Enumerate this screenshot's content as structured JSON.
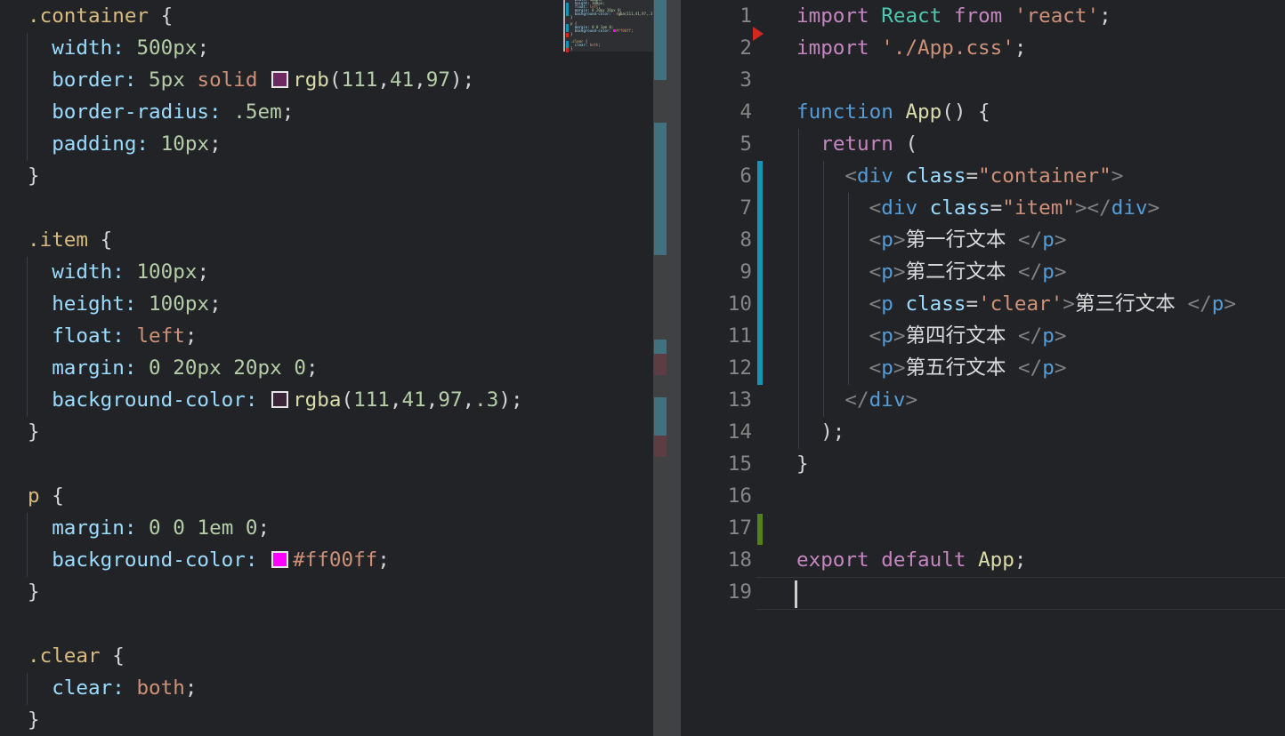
{
  "app": {
    "type": "code-editor-split-view"
  },
  "palette": {
    "k": "#C586C0",
    "s": "#569CD6",
    "c": "#4EC9B0",
    "f": "#DCDCAA",
    "str": "#CE9178",
    "a": "#9CDCFE",
    "n": "#B5CEA8",
    "p": "#D4D4D4",
    "g": "#808080",
    "t": "#569CD6",
    "sel": "#D7BA7D",
    "v": "#CE9178",
    "fn": "#DCDCAA",
    "txt": "#DCDCDC"
  },
  "ui_colors": {
    "bg": "#212327",
    "rulerBase": "#404143",
    "rulerModified": "#41707f",
    "rulerDeleted": "#5e3c43",
    "gutterModified": "#1792b6",
    "gutterAdded": "#54801a",
    "deletedMark": "#d2281e",
    "cursor": "#cfcfcf",
    "lineNumber": "#858585",
    "indentGuide": "#3b3f45",
    "currentLineBorder": "#32353a",
    "minimapSliderEdge": "#b5b5b5",
    "swatchBorder": "#e6e6e6"
  },
  "left_editor": {
    "language": "css",
    "lines": [
      [
        {
          "t": ".container",
          "c": "sel"
        },
        {
          "t": " {",
          "c": "p"
        }
      ],
      [
        {
          "t": "  width:",
          "c": "a"
        },
        {
          "t": " ",
          "c": "p"
        },
        {
          "t": "500px",
          "c": "n"
        },
        {
          "t": ";",
          "c": "p"
        }
      ],
      [
        {
          "t": "  border:",
          "c": "a"
        },
        {
          "t": " ",
          "c": "p"
        },
        {
          "t": "5px",
          "c": "n"
        },
        {
          "t": " ",
          "c": "p"
        },
        {
          "t": "solid",
          "c": "v"
        },
        {
          "t": " ",
          "c": "p"
        },
        {
          "swatch": "#6f2961"
        },
        {
          "t": "rgb",
          "c": "fn"
        },
        {
          "t": "(",
          "c": "p"
        },
        {
          "t": "111",
          "c": "n"
        },
        {
          "t": ",",
          "c": "p"
        },
        {
          "t": "41",
          "c": "n"
        },
        {
          "t": ",",
          "c": "p"
        },
        {
          "t": "97",
          "c": "n"
        },
        {
          "t": ");",
          "c": "p"
        }
      ],
      [
        {
          "t": "  border-radius:",
          "c": "a"
        },
        {
          "t": " ",
          "c": "p"
        },
        {
          "t": ".5em",
          "c": "n"
        },
        {
          "t": ";",
          "c": "p"
        }
      ],
      [
        {
          "t": "  padding:",
          "c": "a"
        },
        {
          "t": " ",
          "c": "p"
        },
        {
          "t": "10px",
          "c": "n"
        },
        {
          "t": ";",
          "c": "p"
        }
      ],
      [
        {
          "t": "}",
          "c": "p"
        }
      ],
      [],
      [
        {
          "t": ".item",
          "c": "sel"
        },
        {
          "t": " {",
          "c": "p"
        }
      ],
      [
        {
          "t": "  width:",
          "c": "a"
        },
        {
          "t": " ",
          "c": "p"
        },
        {
          "t": "100px",
          "c": "n"
        },
        {
          "t": ";",
          "c": "p"
        }
      ],
      [
        {
          "t": "  height:",
          "c": "a"
        },
        {
          "t": " ",
          "c": "p"
        },
        {
          "t": "100px",
          "c": "n"
        },
        {
          "t": ";",
          "c": "p"
        }
      ],
      [
        {
          "t": "  float:",
          "c": "a"
        },
        {
          "t": " ",
          "c": "p"
        },
        {
          "t": "left",
          "c": "v"
        },
        {
          "t": ";",
          "c": "p"
        }
      ],
      [
        {
          "t": "  margin:",
          "c": "a"
        },
        {
          "t": " ",
          "c": "p"
        },
        {
          "t": "0",
          "c": "n"
        },
        {
          "t": " ",
          "c": "p"
        },
        {
          "t": "20px",
          "c": "n"
        },
        {
          "t": " ",
          "c": "p"
        },
        {
          "t": "20px",
          "c": "n"
        },
        {
          "t": " ",
          "c": "p"
        },
        {
          "t": "0",
          "c": "n"
        },
        {
          "t": ";",
          "c": "p"
        }
      ],
      [
        {
          "t": "  background-color:",
          "c": "a"
        },
        {
          "t": " ",
          "c": "p"
        },
        {
          "swatch": "rgba(111,41,97,0.3)"
        },
        {
          "t": "rgba",
          "c": "fn"
        },
        {
          "t": "(",
          "c": "p"
        },
        {
          "t": "111",
          "c": "n"
        },
        {
          "t": ",",
          "c": "p"
        },
        {
          "t": "41",
          "c": "n"
        },
        {
          "t": ",",
          "c": "p"
        },
        {
          "t": "97",
          "c": "n"
        },
        {
          "t": ",",
          "c": "p"
        },
        {
          "t": ".3",
          "c": "n"
        },
        {
          "t": ");",
          "c": "p"
        }
      ],
      [
        {
          "t": "}",
          "c": "p"
        }
      ],
      [],
      [
        {
          "t": "p",
          "c": "sel"
        },
        {
          "t": " {",
          "c": "p"
        }
      ],
      [
        {
          "t": "  margin:",
          "c": "a"
        },
        {
          "t": " ",
          "c": "p"
        },
        {
          "t": "0",
          "c": "n"
        },
        {
          "t": " ",
          "c": "p"
        },
        {
          "t": "0",
          "c": "n"
        },
        {
          "t": " ",
          "c": "p"
        },
        {
          "t": "1em",
          "c": "n"
        },
        {
          "t": " ",
          "c": "p"
        },
        {
          "t": "0",
          "c": "n"
        },
        {
          "t": ";",
          "c": "p"
        }
      ],
      [
        {
          "t": "  background-color:",
          "c": "a"
        },
        {
          "t": " ",
          "c": "p"
        },
        {
          "swatch": "#ff00ff"
        },
        {
          "t": "#ff00ff",
          "c": "v"
        },
        {
          "t": ";",
          "c": "p"
        }
      ],
      [
        {
          "t": "}",
          "c": "p"
        }
      ],
      [],
      [
        {
          "t": ".clear",
          "c": "sel"
        },
        {
          "t": " {",
          "c": "p"
        }
      ],
      [
        {
          "t": "  clear:",
          "c": "a"
        },
        {
          "t": " ",
          "c": "p"
        },
        {
          "t": "both",
          "c": "v"
        },
        {
          "t": ";",
          "c": "p"
        }
      ],
      [
        {
          "t": "}",
          "c": "p"
        }
      ]
    ]
  },
  "minimap": {
    "first_visible_css_line": 9
  },
  "right_editor": {
    "language": "javascriptreact",
    "line_count": 19,
    "lines": [
      [
        {
          "t": "import",
          "c": "k"
        },
        {
          "t": " ",
          "c": "p"
        },
        {
          "t": "React",
          "c": "c"
        },
        {
          "t": " ",
          "c": "p"
        },
        {
          "t": "from",
          "c": "k"
        },
        {
          "t": " ",
          "c": "p"
        },
        {
          "t": "'react'",
          "c": "str"
        },
        {
          "t": ";",
          "c": "p"
        }
      ],
      [
        {
          "t": "import",
          "c": "k"
        },
        {
          "t": " ",
          "c": "p"
        },
        {
          "t": "'./App.css'",
          "c": "str"
        },
        {
          "t": ";",
          "c": "p"
        }
      ],
      [],
      [
        {
          "t": "function",
          "c": "s"
        },
        {
          "t": " ",
          "c": "p"
        },
        {
          "t": "App",
          "c": "f"
        },
        {
          "t": "() {",
          "c": "p"
        }
      ],
      [
        {
          "t": "  ",
          "c": "p"
        },
        {
          "t": "return",
          "c": "k"
        },
        {
          "t": " (",
          "c": "p"
        }
      ],
      [
        {
          "t": "    ",
          "c": "p"
        },
        {
          "t": "<",
          "c": "g"
        },
        {
          "t": "div",
          "c": "t"
        },
        {
          "t": " ",
          "c": "p"
        },
        {
          "t": "class",
          "c": "a"
        },
        {
          "t": "=",
          "c": "p"
        },
        {
          "t": "\"container\"",
          "c": "str"
        },
        {
          "t": ">",
          "c": "g"
        }
      ],
      [
        {
          "t": "      ",
          "c": "p"
        },
        {
          "t": "<",
          "c": "g"
        },
        {
          "t": "div",
          "c": "t"
        },
        {
          "t": " ",
          "c": "p"
        },
        {
          "t": "class",
          "c": "a"
        },
        {
          "t": "=",
          "c": "p"
        },
        {
          "t": "\"item\"",
          "c": "str"
        },
        {
          "t": ">",
          "c": "g"
        },
        {
          "t": "</",
          "c": "g"
        },
        {
          "t": "div",
          "c": "t"
        },
        {
          "t": ">",
          "c": "g"
        }
      ],
      [
        {
          "t": "      ",
          "c": "p"
        },
        {
          "t": "<",
          "c": "g"
        },
        {
          "t": "p",
          "c": "t"
        },
        {
          "t": ">",
          "c": "g"
        },
        {
          "t": "第一行文本 ",
          "c": "txt"
        },
        {
          "t": "</",
          "c": "g"
        },
        {
          "t": "p",
          "c": "t"
        },
        {
          "t": ">",
          "c": "g"
        }
      ],
      [
        {
          "t": "      ",
          "c": "p"
        },
        {
          "t": "<",
          "c": "g"
        },
        {
          "t": "p",
          "c": "t"
        },
        {
          "t": ">",
          "c": "g"
        },
        {
          "t": "第二行文本 ",
          "c": "txt"
        },
        {
          "t": "</",
          "c": "g"
        },
        {
          "t": "p",
          "c": "t"
        },
        {
          "t": ">",
          "c": "g"
        }
      ],
      [
        {
          "t": "      ",
          "c": "p"
        },
        {
          "t": "<",
          "c": "g"
        },
        {
          "t": "p",
          "c": "t"
        },
        {
          "t": " ",
          "c": "p"
        },
        {
          "t": "class",
          "c": "a"
        },
        {
          "t": "=",
          "c": "p"
        },
        {
          "t": "'clear'",
          "c": "str"
        },
        {
          "t": ">",
          "c": "g"
        },
        {
          "t": "第三行文本 ",
          "c": "txt"
        },
        {
          "t": "</",
          "c": "g"
        },
        {
          "t": "p",
          "c": "t"
        },
        {
          "t": ">",
          "c": "g"
        }
      ],
      [
        {
          "t": "      ",
          "c": "p"
        },
        {
          "t": "<",
          "c": "g"
        },
        {
          "t": "p",
          "c": "t"
        },
        {
          "t": ">",
          "c": "g"
        },
        {
          "t": "第四行文本 ",
          "c": "txt"
        },
        {
          "t": "</",
          "c": "g"
        },
        {
          "t": "p",
          "c": "t"
        },
        {
          "t": ">",
          "c": "g"
        }
      ],
      [
        {
          "t": "      ",
          "c": "p"
        },
        {
          "t": "<",
          "c": "g"
        },
        {
          "t": "p",
          "c": "t"
        },
        {
          "t": ">",
          "c": "g"
        },
        {
          "t": "第五行文本 ",
          "c": "txt"
        },
        {
          "t": "</",
          "c": "g"
        },
        {
          "t": "p",
          "c": "t"
        },
        {
          "t": ">",
          "c": "g"
        }
      ],
      [
        {
          "t": "    ",
          "c": "p"
        },
        {
          "t": "</",
          "c": "g"
        },
        {
          "t": "div",
          "c": "t"
        },
        {
          "t": ">",
          "c": "g"
        }
      ],
      [
        {
          "t": "  );",
          "c": "p"
        }
      ],
      [
        {
          "t": "}",
          "c": "p"
        }
      ],
      [],
      [],
      [
        {
          "t": "export",
          "c": "k"
        },
        {
          "t": " ",
          "c": "p"
        },
        {
          "t": "default",
          "c": "k"
        },
        {
          "t": " ",
          "c": "p"
        },
        {
          "t": "App",
          "c": "f"
        },
        {
          "t": ";",
          "c": "p"
        }
      ],
      []
    ]
  },
  "cursor": {
    "line": 19,
    "column": 1
  }
}
